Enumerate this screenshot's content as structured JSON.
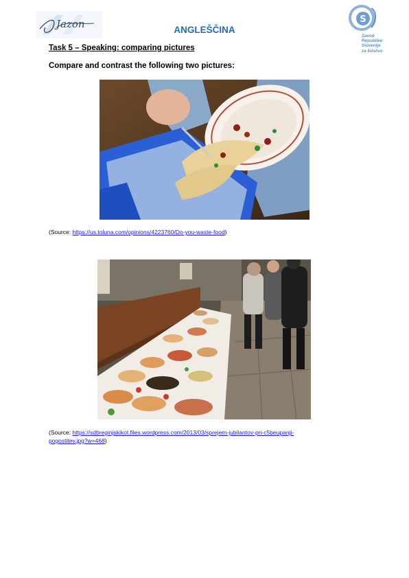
{
  "header": {
    "subject": "ANGLEŠČINA",
    "left_logo_text": "Jazon",
    "right_logo_lines": [
      "Zavod",
      "Republike",
      "Slovenije",
      "za šolstvo"
    ],
    "right_logo_letter": "S"
  },
  "task": {
    "title": "Task 5 – Speaking: comparing pictures",
    "instruction": "Compare and contrast the following two pictures:"
  },
  "pictures": [
    {
      "description_icon": "food-waste-photo",
      "source_prefix": "(Source: ",
      "source_link": "https://us.toluna.com/opinions/4223760/Do-you-waste-food",
      "source_suffix": ")"
    },
    {
      "description_icon": "buffet-photo",
      "source_prefix": "(Source: ",
      "source_link_line1": "https://sdbreginjskikot.files.wordpress.com/2013/03/sprejem-jubilantov-pri-c5beupanji-",
      "source_link_line2": "pogostitev.jpg?w=468",
      "source_suffix": ")"
    }
  ],
  "colors": {
    "subject": "#1f6fb6",
    "link": "#1a1ad6",
    "logo_blue": "#5b8fc8"
  }
}
